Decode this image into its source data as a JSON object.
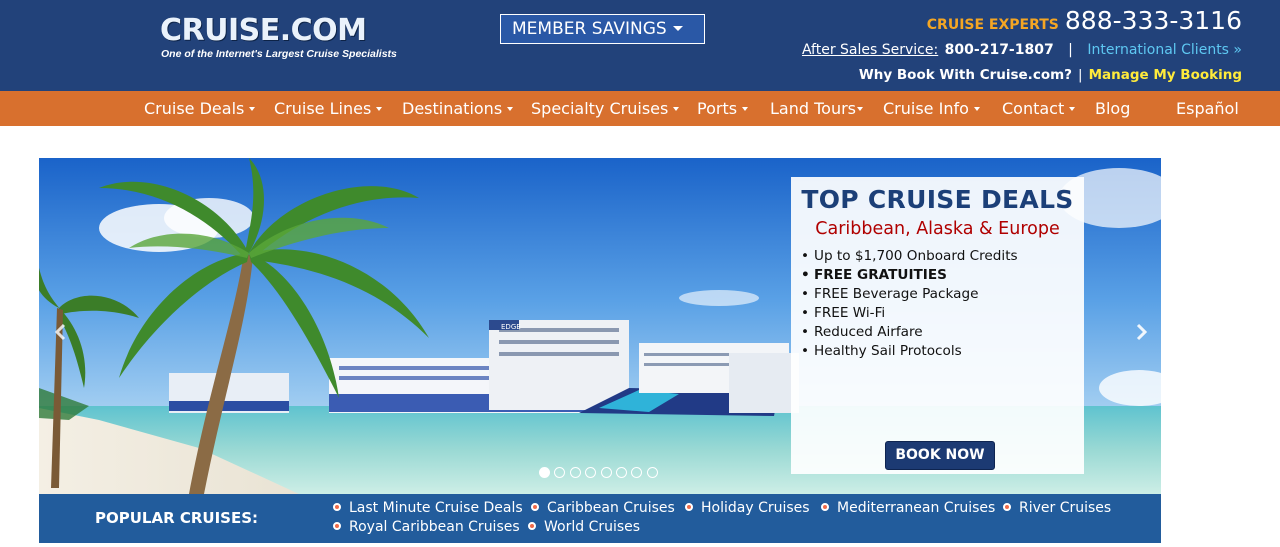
{
  "header": {
    "logo_text": "CRUISE.COM",
    "logo_tagline": "One of the Internet's Largest Cruise Specialists",
    "member_savings_label": "MEMBER SAVINGS",
    "experts_label": "CRUISE EXPERTS",
    "experts_phone": "888-333-3116",
    "after_sales_label": "After Sales Service:",
    "after_sales_phone": "800-217-1807",
    "separator": "|",
    "international_label": "International Clients »",
    "why_book_label": "Why Book With Cruise.com?",
    "manage_booking_label": "Manage My Booking"
  },
  "nav": {
    "items": [
      {
        "label": "Cruise Deals",
        "has_dropdown": true
      },
      {
        "label": "Cruise Lines",
        "has_dropdown": true
      },
      {
        "label": "Destinations",
        "has_dropdown": true
      },
      {
        "label": "Specialty Cruises",
        "has_dropdown": true
      },
      {
        "label": "Ports",
        "has_dropdown": true
      },
      {
        "label": "Land Tours",
        "has_dropdown": true
      },
      {
        "label": "Cruise Info",
        "has_dropdown": true
      },
      {
        "label": "Contact",
        "has_dropdown": true
      },
      {
        "label": "Blog",
        "has_dropdown": false
      },
      {
        "label": "Español",
        "has_dropdown": false
      }
    ]
  },
  "hero": {
    "card_title": "TOP CRUISE DEALS",
    "card_subtitle": "Caribbean, Alaska & Europe",
    "bullets": [
      "Up to $1,700 Onboard Credits",
      "FREE GRATUITIES",
      "FREE Beverage Package",
      "FREE Wi-Fi",
      "Reduced Airfare",
      "Healthy Sail Protocols"
    ],
    "book_now_label": "BOOK NOW",
    "slide_count": 8,
    "active_slide": 1,
    "ship_name": "EDGE"
  },
  "popular": {
    "label": "POPULAR CRUISES:",
    "links": [
      "Last Minute Cruise Deals",
      "Caribbean Cruises",
      "Holiday Cruises",
      "Mediterranean Cruises",
      "River Cruises",
      "Royal Caribbean Cruises",
      "World Cruises"
    ]
  },
  "colors": {
    "header_bg": "#22427a",
    "nav_bg": "#d8702e",
    "experts_accent": "#f5a623",
    "international_link": "#5ec8f2",
    "manage_booking": "#ffeb3b",
    "card_title": "#1c3f78",
    "card_subtitle": "#b00000",
    "book_button": "#1c3a73",
    "popular_bg": "#225c9c",
    "popular_dot": "#f06b4a"
  },
  "icons": {
    "dropdown": "chevron-down-icon",
    "slider_prev": "chevron-left-icon",
    "slider_next": "chevron-right-icon",
    "bullet": "bullet-dot-icon"
  }
}
